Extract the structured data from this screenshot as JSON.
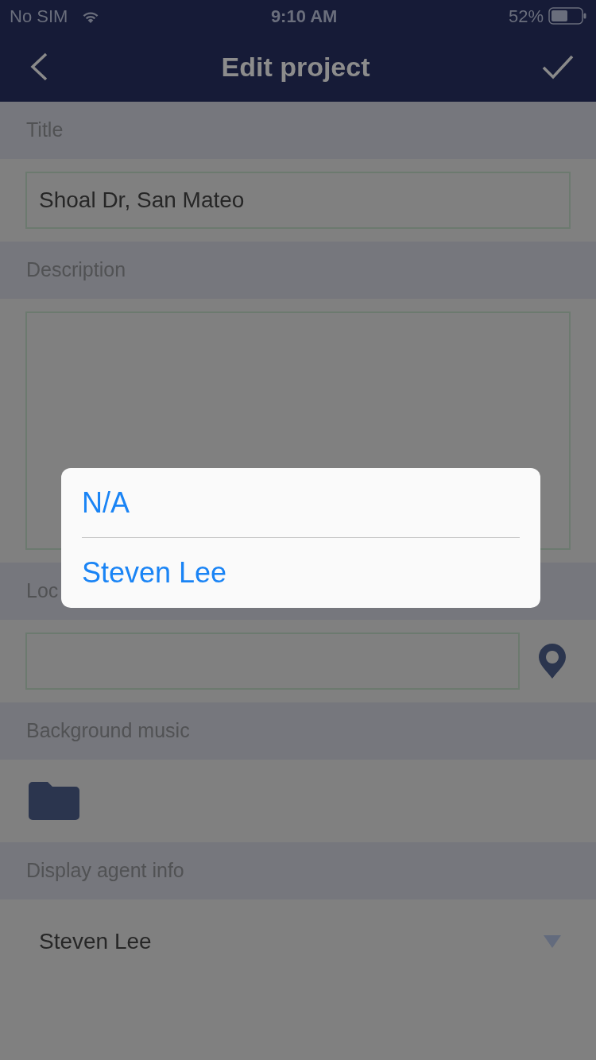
{
  "status_bar": {
    "carrier": "No SIM",
    "time": "9:10 AM",
    "battery": "52%"
  },
  "nav_bar": {
    "title": "Edit project"
  },
  "sections": [
    {
      "kind": "text",
      "label": "Title",
      "value": "Shoal Dr, San Mateo"
    },
    {
      "kind": "textarea",
      "label": "Description"
    },
    {
      "kind": "location",
      "label": "Loc"
    },
    {
      "kind": "music",
      "label": "Background music"
    },
    {
      "kind": "select",
      "label": "Display agent info",
      "value": "Steven Lee"
    }
  ],
  "popup": {
    "options": [
      {
        "label": "N/A"
      },
      {
        "label": "Steven Lee"
      }
    ]
  }
}
